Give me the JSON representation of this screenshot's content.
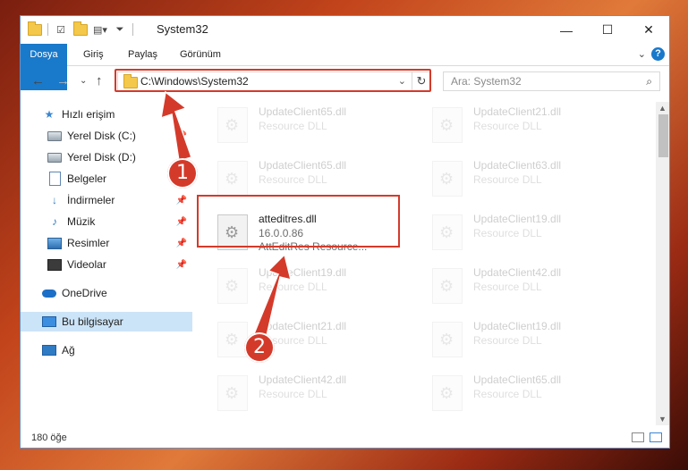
{
  "window": {
    "title": "System32",
    "controls": {
      "minimize": "—",
      "maximize": "☐",
      "close": "✕"
    }
  },
  "ribbon": {
    "tabs": [
      {
        "label": "Dosya"
      },
      {
        "label": "Giriş"
      },
      {
        "label": "Paylaş"
      },
      {
        "label": "Görünüm"
      }
    ],
    "help": "?"
  },
  "address": {
    "path": "C:\\Windows\\System32",
    "search_placeholder": "Ara: System32"
  },
  "sidebar": {
    "items": [
      {
        "label": "Hızlı erişim",
        "icon": "star-icon"
      },
      {
        "label": "Yerel Disk (C:)",
        "icon": "disk-icon",
        "pinned": true
      },
      {
        "label": "Yerel Disk (D:)",
        "icon": "disk-icon",
        "pinned": true
      },
      {
        "label": "Belgeler",
        "icon": "documents-icon",
        "pinned": true
      },
      {
        "label": "İndirmeler",
        "icon": "downloads-icon",
        "pinned": true
      },
      {
        "label": "Müzik",
        "icon": "music-icon",
        "pinned": true
      },
      {
        "label": "Resimler",
        "icon": "pictures-icon",
        "pinned": true
      },
      {
        "label": "Videolar",
        "icon": "videos-icon",
        "pinned": true
      },
      {
        "label": "OneDrive",
        "icon": "onedrive-icon"
      },
      {
        "label": "Bu bilgisayar",
        "icon": "computer-icon",
        "selected": true
      },
      {
        "label": "Ağ",
        "icon": "network-icon"
      }
    ]
  },
  "files": [
    {
      "name": "UpdateClient65.dll",
      "type": "Resource DLL"
    },
    {
      "name": "UpdateClient21.dll",
      "type": "Resource DLL"
    },
    {
      "name": "UpdateClient65.dll",
      "type": "Resource DLL"
    },
    {
      "name": "UpdateClient63.dll",
      "type": "Resource DLL"
    },
    {
      "name": "atteditres.dll",
      "version": "16.0.0.86",
      "type": "AttEditRes Resource...",
      "highlighted": true
    },
    {
      "name": "UpdateClient19.dll",
      "type": "Resource DLL"
    },
    {
      "name": "UpdateClient19.dll",
      "type": "Resource DLL"
    },
    {
      "name": "UpdateClient42.dll",
      "type": "Resource DLL"
    },
    {
      "name": "UpdateClient21.dll",
      "type": "Resource DLL"
    },
    {
      "name": "UpdateClient19.dll",
      "type": "Resource DLL"
    },
    {
      "name": "UpdateClient42.dll",
      "type": "Resource DLL"
    },
    {
      "name": "UpdateClient65.dll",
      "type": "Resource DLL"
    }
  ],
  "status": {
    "item_count": "180 öğe"
  },
  "annotations": {
    "step1": "1",
    "step2": "2",
    "color": "#d43a2a"
  }
}
